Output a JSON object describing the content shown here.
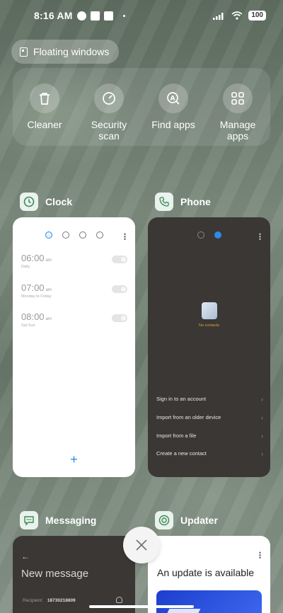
{
  "status_bar": {
    "time": "8:16 AM",
    "battery": "100"
  },
  "floating_windows": {
    "label": "Floating windows"
  },
  "quick_actions": [
    {
      "label": "Cleaner",
      "icon": "trash-icon"
    },
    {
      "label": "Security\nscan",
      "icon": "security-scan-icon"
    },
    {
      "label": "Find apps",
      "icon": "find-apps-icon"
    },
    {
      "label": "Manage\napps",
      "icon": "grid-icon"
    }
  ],
  "apps": {
    "clock": {
      "name": "Clock",
      "alarms": [
        {
          "time": "06:00",
          "ampm": "am",
          "sub": "Daily"
        },
        {
          "time": "07:00",
          "ampm": "am",
          "sub": "Monday to Friday"
        },
        {
          "time": "08:00",
          "ampm": "am",
          "sub": "Sat Sun"
        }
      ],
      "add": "+"
    },
    "phone": {
      "name": "Phone",
      "empty": "No contacts",
      "options": [
        "Sign in to an account",
        "Import from an older device",
        "Import from a file",
        "Create a new contact"
      ]
    },
    "messaging": {
      "name": "Messaging",
      "back": "←",
      "title": "New message",
      "recipient_label": "Recipient:",
      "recipient_value": "18730218809"
    },
    "updater": {
      "name": "Updater",
      "title": "An update is available"
    }
  },
  "colors": {
    "accent": "#2b8be6",
    "contacts_hint": "#d6a53a"
  }
}
